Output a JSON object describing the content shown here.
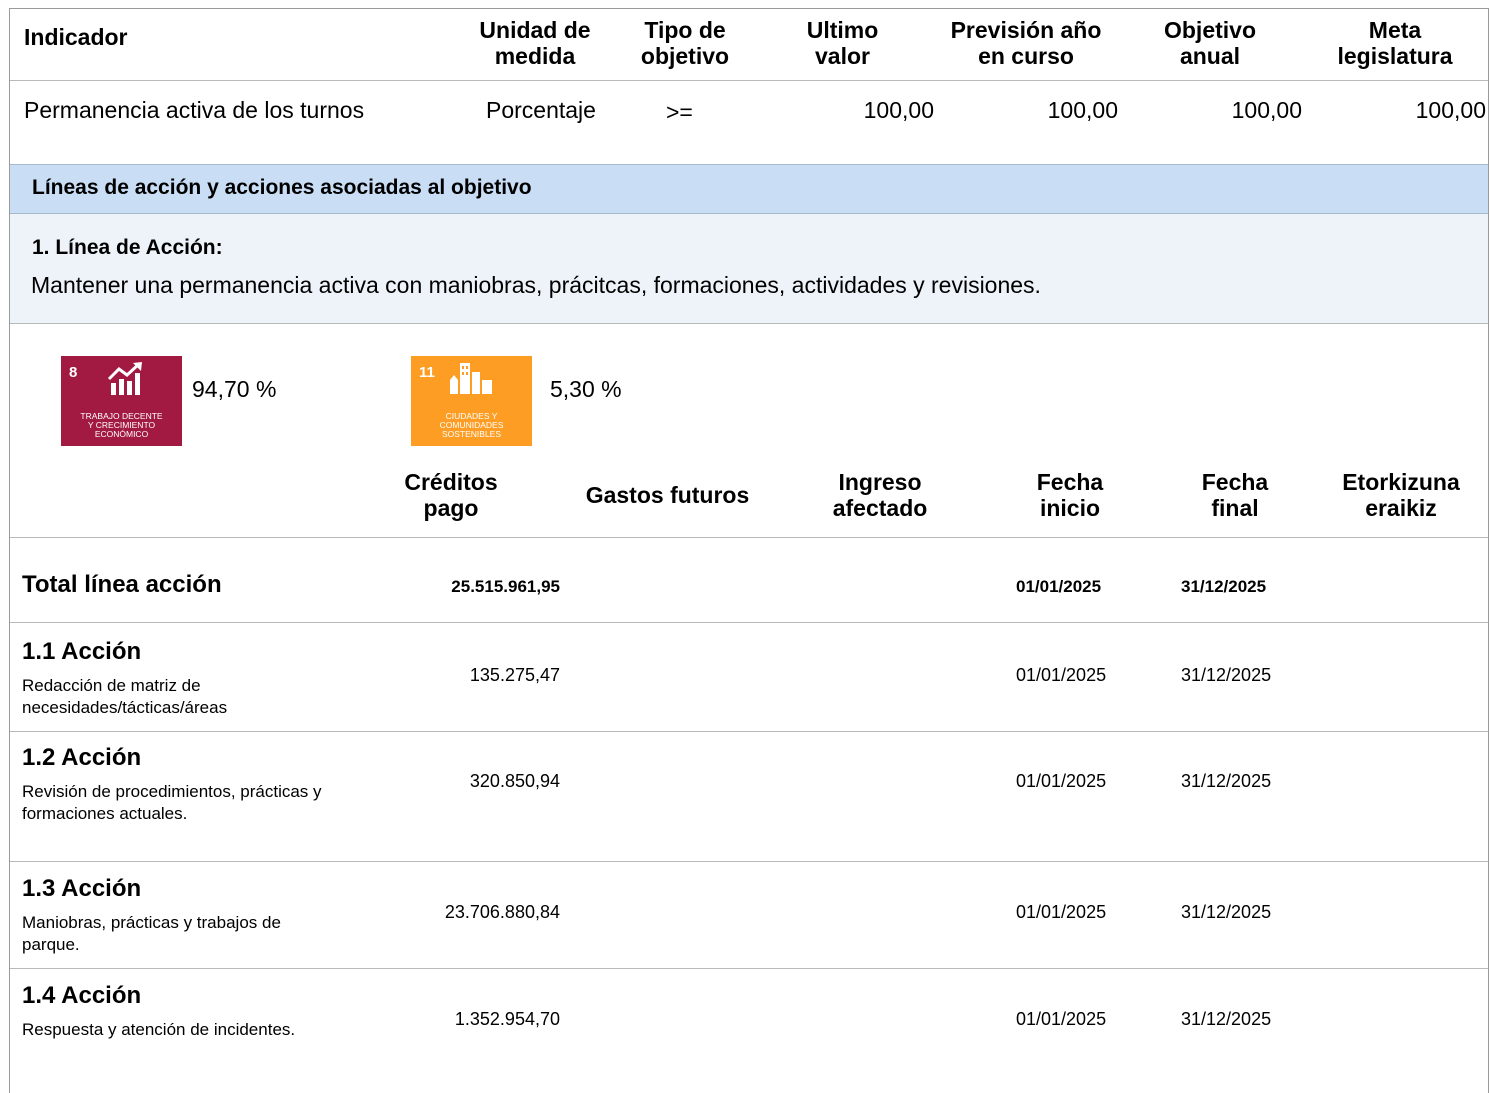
{
  "indicator_table": {
    "headers": {
      "indicador": "Indicador",
      "unidad": [
        "Unidad de",
        "medida"
      ],
      "tipo": [
        "Tipo de",
        "objetivo"
      ],
      "ultimo": [
        "Ultimo",
        "valor"
      ],
      "prevision": [
        "Previsión año",
        "en curso"
      ],
      "objetivo": [
        "Objetivo",
        "anual"
      ],
      "meta": [
        "Meta",
        "legislatura"
      ]
    },
    "row": {
      "indicador": "Permanencia activa de los turnos",
      "unidad": "Porcentaje",
      "tipo": ">=",
      "ultimo": "100,00",
      "prevision": "100,00",
      "objetivo": "100,00",
      "meta": "100,00"
    }
  },
  "section_band": "Líneas de acción y acciones asociadas al objetivo",
  "linea": {
    "title": "1. Línea de Acción:",
    "description": "Mantener una permanencia activa con maniobras, prácitcas, formaciones, actividades y revisiones."
  },
  "ods": [
    {
      "number": "8",
      "label_lines": [
        "TRABAJO DECENTE",
        "Y CRECIMIENTO",
        "ECONÓMICO"
      ],
      "color": "#a21942",
      "icon": "growth-chart-icon",
      "percentage": "94,70 %"
    },
    {
      "number": "11",
      "label_lines": [
        "CIUDADES Y",
        "COMUNIDADES",
        "SOSTENIBLES"
      ],
      "color": "#fd9d24",
      "icon": "city-buildings-icon",
      "percentage": "5,30 %"
    }
  ],
  "budget_headers": {
    "creditos": [
      "Créditos",
      "pago"
    ],
    "gastos": "Gastos futuros",
    "ingreso": [
      "Ingreso",
      "afectado"
    ],
    "fecha_inicio": [
      "Fecha",
      "inicio"
    ],
    "fecha_final": [
      "Fecha",
      "final"
    ],
    "etorkizuna": [
      "Etorkizuna",
      "eraikiz"
    ]
  },
  "total": {
    "label": "Total línea acción",
    "creditos": "25.515.961,95",
    "fecha_inicio": "01/01/2025",
    "fecha_final": "31/12/2025"
  },
  "acciones": [
    {
      "title": "1.1 Acción",
      "description": "Redacción de matriz de necesidades/tácticas/áreas",
      "creditos": "135.275,47",
      "fecha_inicio": "01/01/2025",
      "fecha_final": "31/12/2025"
    },
    {
      "title": "1.2 Acción",
      "description": "Revisión de procedimientos, prácticas y formaciones actuales.",
      "creditos": "320.850,94",
      "fecha_inicio": "01/01/2025",
      "fecha_final": "31/12/2025"
    },
    {
      "title": "1.3 Acción",
      "description": "Maniobras, prácticas y trabajos de parque.",
      "creditos": "23.706.880,84",
      "fecha_inicio": "01/01/2025",
      "fecha_final": "31/12/2025"
    },
    {
      "title": "1.4 Acción",
      "description": "Respuesta y atención de incidentes.",
      "creditos": "1.352.954,70",
      "fecha_inicio": "01/01/2025",
      "fecha_final": "31/12/2025"
    }
  ]
}
